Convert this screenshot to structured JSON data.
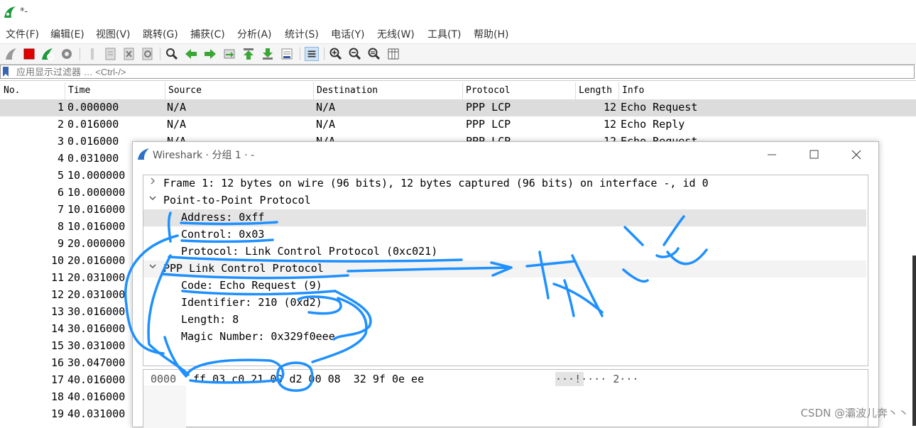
{
  "window": {
    "title": "*-"
  },
  "menu": [
    "文件(F)",
    "编辑(E)",
    "视图(V)",
    "跳转(G)",
    "捕获(C)",
    "分析(A)",
    "统计(S)",
    "电话(Y)",
    "无线(W)",
    "工具(T)",
    "帮助(H)"
  ],
  "filter": {
    "placeholder": "应用显示过滤器 … <Ctrl-/>"
  },
  "packet_list": {
    "columns": [
      "No.",
      "Time",
      "Source",
      "Destination",
      "Protocol",
      "Length",
      "Info"
    ],
    "rows": [
      {
        "no": "1",
        "time": "0.000000",
        "src": "N/A",
        "dst": "N/A",
        "proto": "PPP LCP",
        "len": "12",
        "info": "Echo Request"
      },
      {
        "no": "2",
        "time": "0.016000",
        "src": "N/A",
        "dst": "N/A",
        "proto": "PPP LCP",
        "len": "12",
        "info": "Echo Reply"
      },
      {
        "no": "3",
        "time": "0.016000",
        "src": "N/A",
        "dst": "N/A",
        "proto": "PPP LCP",
        "len": "12",
        "info": "Echo Request"
      },
      {
        "no": "4",
        "time": "0.031000"
      },
      {
        "no": "5",
        "time": "10.000000"
      },
      {
        "no": "6",
        "time": "10.000000"
      },
      {
        "no": "7",
        "time": "10.016000"
      },
      {
        "no": "8",
        "time": "10.016000"
      },
      {
        "no": "9",
        "time": "20.000000"
      },
      {
        "no": "10",
        "time": "20.016000"
      },
      {
        "no": "11",
        "time": "20.031000"
      },
      {
        "no": "12",
        "time": "20.031000"
      },
      {
        "no": "13",
        "time": "30.016000"
      },
      {
        "no": "14",
        "time": "30.016000"
      },
      {
        "no": "15",
        "time": "30.031000"
      },
      {
        "no": "16",
        "time": "30.047000"
      },
      {
        "no": "17",
        "time": "40.016000"
      },
      {
        "no": "18",
        "time": "40.016000"
      },
      {
        "no": "19",
        "time": "40.031000"
      }
    ]
  },
  "dialog": {
    "title": "Wireshark · 分组 1 · -",
    "tree": [
      {
        "arrow": ">",
        "text": "Frame 1: 12 bytes on wire (96 bits), 12 bytes captured (96 bits) on interface -, id 0"
      },
      {
        "arrow": "v",
        "text": "Point-to-Point Protocol"
      },
      {
        "arrow": "",
        "text": "Address: 0xff"
      },
      {
        "arrow": "",
        "text": "Control: 0x03"
      },
      {
        "arrow": "",
        "text": "Protocol: Link Control Protocol (0xc021)"
      },
      {
        "arrow": "v",
        "text": "PPP Link Control Protocol"
      },
      {
        "arrow": "",
        "text": "Code: Echo Request (9)"
      },
      {
        "arrow": "",
        "text": "Identifier: 210 (0xd2)"
      },
      {
        "arrow": "",
        "text": "Length: 8"
      },
      {
        "arrow": "",
        "text": "Magic Number: 0x329f0eee"
      }
    ],
    "bytes": {
      "offset": "0000",
      "hex": "ff 03 c0 21 09 d2 00 08  32 9f 0e ee",
      "ascii": "···!···· 2···"
    }
  },
  "handwriting": "协议",
  "watermark": "CSDN @灞波儿奔丶丶",
  "colors": {
    "ink": "#1e90ff",
    "selected_row": "#dcdcdc"
  }
}
